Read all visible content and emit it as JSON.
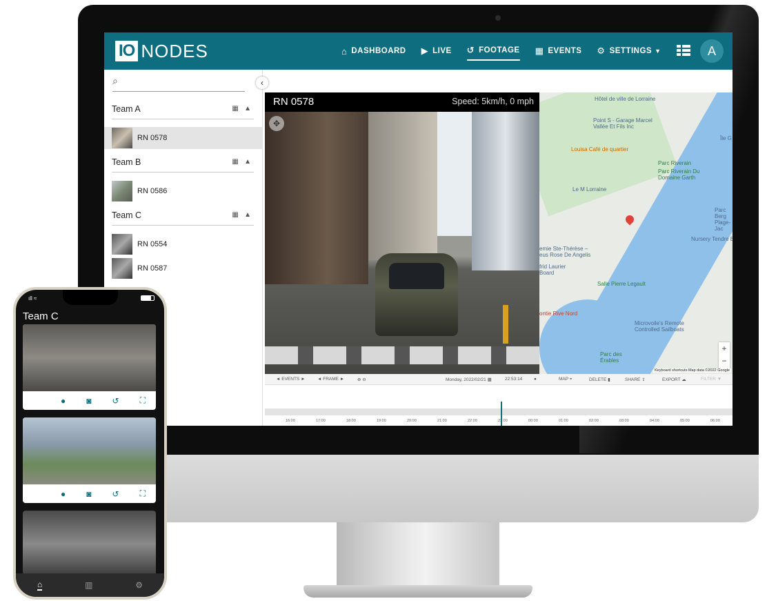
{
  "app": {
    "logo_io": "IO",
    "logo_nodes": "NODES",
    "avatar_initial": "A"
  },
  "nav": [
    {
      "label": "DASHBOARD",
      "icon": "home-icon",
      "glyph": "⌂"
    },
    {
      "label": "LIVE",
      "icon": "play-icon",
      "glyph": "▶"
    },
    {
      "label": "FOOTAGE",
      "icon": "history-icon",
      "glyph": "↺"
    },
    {
      "label": "EVENTS",
      "icon": "film-icon",
      "glyph": "▦"
    },
    {
      "label": "SETTINGS",
      "icon": "gear-icon",
      "glyph": "⚙"
    }
  ],
  "sidebar": {
    "teams": [
      {
        "name": "Team A",
        "cameras": [
          "RN 0578"
        ]
      },
      {
        "name": "Team B",
        "cameras": [
          "RN 0586"
        ]
      },
      {
        "name": "Team C",
        "cameras": [
          "RN 0554",
          "RN 0587"
        ]
      }
    ]
  },
  "video": {
    "camera": "RN 0578",
    "speed": "Speed: 5km/h, 0 mph"
  },
  "map": {
    "labels": [
      "Hôtel de ville de Lorraine",
      "Point S - Garage Marcel Vallée Et Fils Inc",
      "Louisa Café de quartier",
      "Parc Riverain",
      "Parc Riverain Du Domaine Garth",
      "Le M Lorraine",
      "emie Ste-Thérèse – eus Rose De Angelis",
      "frid Laurier Board",
      "Salle Pierre Legault",
      "Nursery Tendre Et",
      "ontie Rive Nord",
      "Microvoile's Remote Controlled Sailboats",
      "Parc des Érables",
      "Île G",
      "Parc Berg Plage-Jac"
    ],
    "credit": "Keyboard shortcuts   Map data ©2022 Google"
  },
  "controls": {
    "events": "EVENTS",
    "frame": "FRAME",
    "date": "Monday, 2022/02/21",
    "time": "22:53:14",
    "map": "MAP",
    "delete": "DELETE",
    "share": "SHARE",
    "export": "EXPORT",
    "filter": "FILTER"
  },
  "timeline": {
    "labels": [
      "16:00",
      "17:00",
      "18:00",
      "19:00",
      "20:00",
      "21:00",
      "22:00",
      "23:00",
      "00:00",
      "01:00",
      "02:00",
      "03:00",
      "04:00",
      "05:00",
      "06:00"
    ]
  },
  "phone": {
    "title": "Team C"
  }
}
